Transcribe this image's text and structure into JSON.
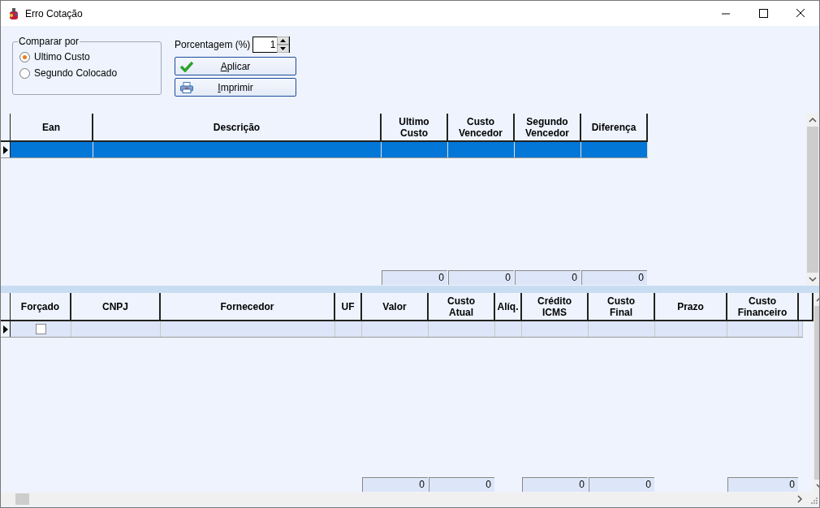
{
  "window": {
    "title": "Erro Cotação"
  },
  "compare": {
    "legend": "Comparar por",
    "options": [
      {
        "label": "Ultimo Custo",
        "selected": true
      },
      {
        "label": "Segundo Colocado",
        "selected": false
      }
    ]
  },
  "percentage": {
    "label": "Porcentagem (%)",
    "value": "1"
  },
  "buttons": [
    {
      "label": "Aplicar",
      "kind": "apply"
    },
    {
      "label": "Imprimir",
      "kind": "print"
    }
  ],
  "top_grid": {
    "columns": [
      {
        "label": "Ean"
      },
      {
        "label": "Descrição"
      },
      {
        "label": "Ultimo Custo",
        "total": "0"
      },
      {
        "label": "Custo Vencedor",
        "total": "0"
      },
      {
        "label": "Segundo Vencedor",
        "total": "0"
      },
      {
        "label": "Diferença",
        "total": "0"
      }
    ],
    "rows": [
      {
        "selected": true
      }
    ]
  },
  "bottom_grid": {
    "columns": [
      {
        "label": "Forçado"
      },
      {
        "label": "CNPJ"
      },
      {
        "label": "Fornecedor"
      },
      {
        "label": "UF"
      },
      {
        "label": "Valor",
        "total": "0"
      },
      {
        "label": "Custo Atual",
        "total": "0"
      },
      {
        "label": "Alíq."
      },
      {
        "label": "Crédito ICMS",
        "total": "0"
      },
      {
        "label": "Custo Final",
        "total": "0"
      },
      {
        "label": "Prazo"
      },
      {
        "label": "Custo Financeiro",
        "total": "0"
      }
    ],
    "rows": [
      {
        "selected": false,
        "checked": false
      }
    ]
  }
}
